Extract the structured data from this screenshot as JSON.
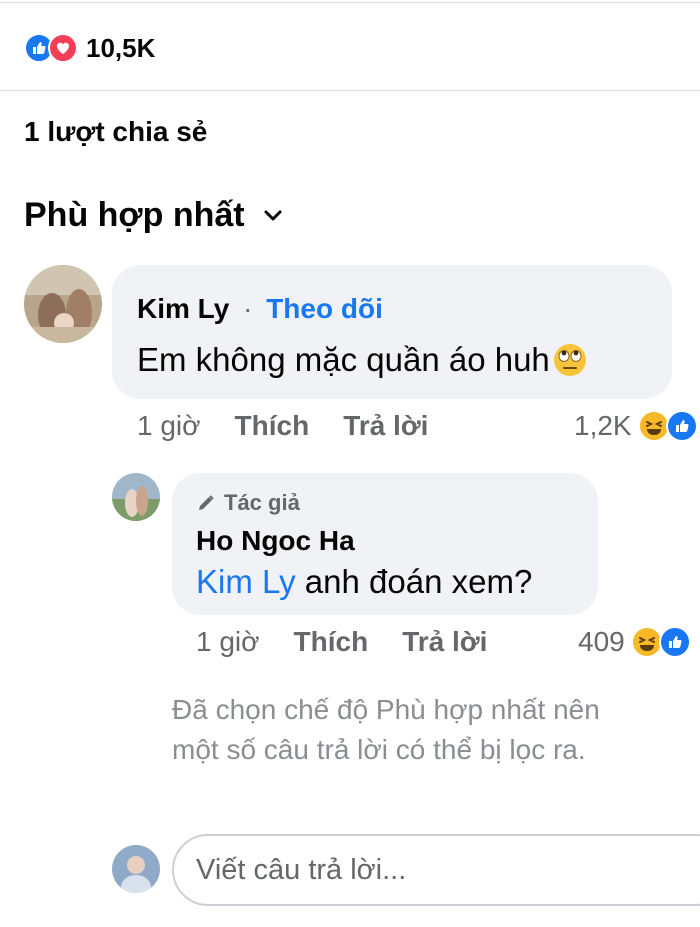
{
  "reactions": {
    "count": "10,5K",
    "types": [
      "like-icon",
      "love-icon"
    ]
  },
  "shares": {
    "text": "1 lượt chia sẻ"
  },
  "sort": {
    "label": "Phù hợp nhất"
  },
  "comments": [
    {
      "author": "Kim Ly",
      "follow": "Theo dõi",
      "separator": "·",
      "text": "Em không mặc quần áo huh",
      "emoji": "face-with-rolling-eyes-emoji",
      "time": "1 giờ",
      "like": "Thích",
      "reply": "Trả lời",
      "reaction_count": "1,2K",
      "reaction_types": [
        "haha-icon",
        "like-icon"
      ]
    }
  ],
  "reply": {
    "badge": "Tác giả",
    "author": "Ho Ngoc Ha",
    "mention": "Kim Ly",
    "text": " anh đoán xem?",
    "time": "1 giờ",
    "like": "Thích",
    "reply": "Trả lời",
    "reaction_count": "409",
    "reaction_types": [
      "haha-icon",
      "like-icon"
    ]
  },
  "notice": "Đã chọn chế độ Phù hợp nhất nên một số câu trả lời có thể bị lọc ra.",
  "composer": {
    "placeholder": "Viết câu trả lời..."
  }
}
